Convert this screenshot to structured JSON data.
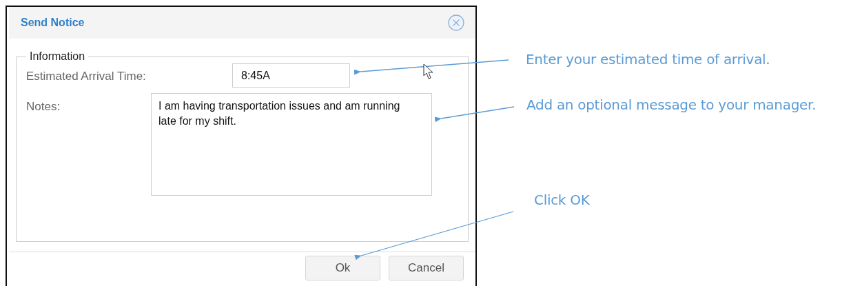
{
  "dialog": {
    "title": "Send Notice",
    "fieldset": {
      "legend": "Information",
      "fields": [
        {
          "kind": "text",
          "label": "Estimated Arrival Time:",
          "value": "8:45A"
        },
        {
          "kind": "textarea",
          "label": "Notes:",
          "value": "I am having transportation issues and am running late for my shift."
        }
      ]
    },
    "buttons": [
      {
        "label": "Ok"
      },
      {
        "label": "Cancel"
      }
    ]
  },
  "callouts": [
    {
      "text": "Enter your estimated time of arrival."
    },
    {
      "text": "Add an optional message to your manager."
    },
    {
      "text": "Click OK"
    }
  ]
}
